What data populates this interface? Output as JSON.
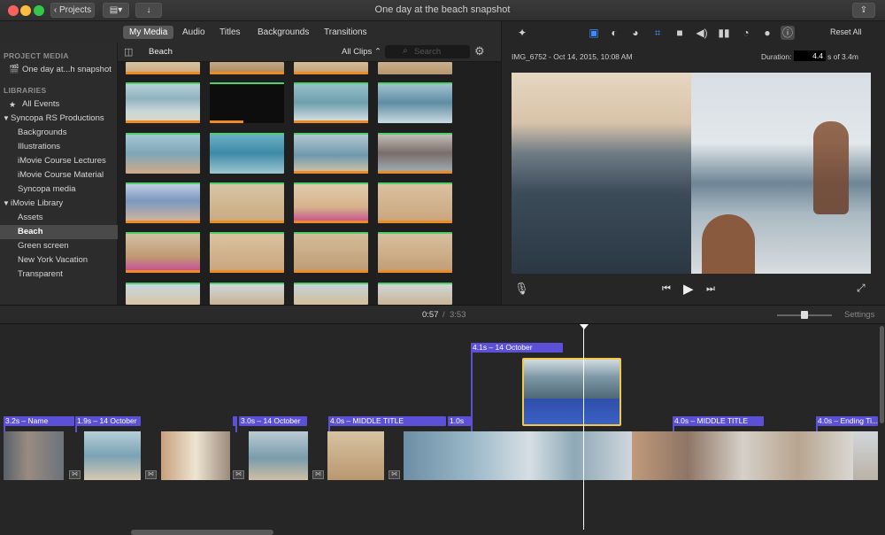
{
  "window": {
    "title": "One day at the beach snapshot",
    "projects_button": "Projects",
    "colors": {
      "close": "#fc605c",
      "minimize": "#fdbc40",
      "zoom": "#34c84a",
      "accent": "#5b50d6",
      "selection": "#f2c94c"
    }
  },
  "media_tabs": [
    "My Media",
    "Audio",
    "Titles",
    "Backgrounds",
    "Transitions"
  ],
  "sidebar": {
    "project_media_header": "PROJECT MEDIA",
    "project_item": "One day at...h snapshot",
    "libraries_header": "LIBRARIES",
    "all_events": "All Events",
    "library_1": "Syncopa RS Productions",
    "library_1_events": [
      "Backgrounds",
      "Illustrations",
      "iMovie Course Lectures",
      "iMovie Course Material",
      "Syncopa media"
    ],
    "library_2": "iMovie Library",
    "library_2_events": [
      "Assets",
      "Beach",
      "Green screen",
      "New York Vacation",
      "Transparent"
    ],
    "selected": "Beach"
  },
  "browser": {
    "event_name": "Beach",
    "filter": "All Clips",
    "search_placeholder": "Search"
  },
  "viewer": {
    "clip_info": "IMG_6752 - Oct 14, 2015, 10:08 AM",
    "duration_label": "Duration:",
    "duration_value": "4.4",
    "duration_suffix": "s of 3.4m",
    "reset_all": "Reset All",
    "tool_icons": [
      "enhance-wand-icon",
      "crop-rect-icon",
      "color-balance-icon",
      "color-correction-icon",
      "crop-icon",
      "stabilization-icon",
      "volume-icon",
      "equalizer-icon",
      "speed-icon",
      "noise-icon",
      "info-icon"
    ]
  },
  "timeline_header": {
    "current_time": "0:57",
    "separator": "/",
    "total_time": "3:53",
    "settings": "Settings",
    "zoom_level": 0.5
  },
  "timeline": {
    "titles": [
      "3.2s – Name",
      "1.9s – 14 October",
      "3.0s – 14 October",
      "4.0s – MIDDLE TITLE",
      "1.0s",
      "4.1s – 14 October",
      "4.0s – MIDDLE TITLE",
      "4.0s – Ending Ti..."
    ]
  }
}
